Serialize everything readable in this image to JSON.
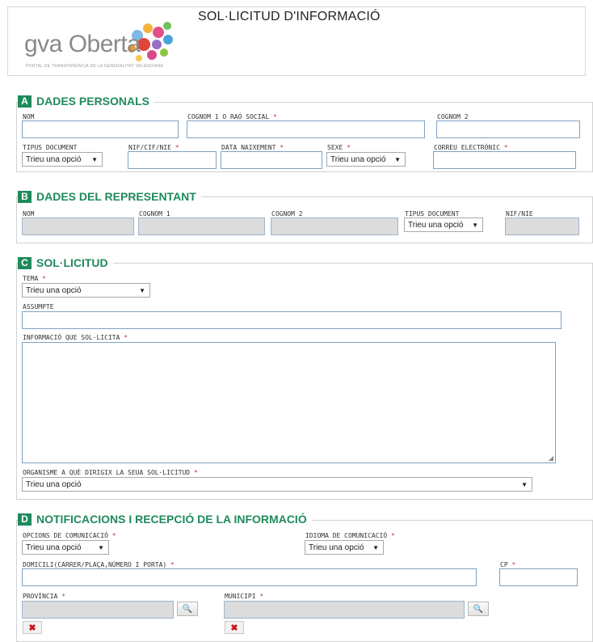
{
  "header": {
    "logo_text": "gva Oberta",
    "logo_subtitle": "PORTAL DE TRANSPARÈNCIA DE LA GENERALITAT VALENCIANA",
    "title": "SOL·LICITUD D'INFORMACIÓ"
  },
  "colors": {
    "accent": "#1f8a5c",
    "required": "#c0392b",
    "input_border": "#7fa3c2",
    "disabled_bg": "#dcdcdc"
  },
  "select_default": "Trieu una opció",
  "required_mark": "*",
  "icons": {
    "search": "magnifier-icon",
    "remove": "x-icon"
  },
  "sections": {
    "a": {
      "badge": "A",
      "title": "DADES PERSONALS",
      "fields": {
        "nom": "NOM",
        "cognom1": "COGNOM 1 O RAÓ SOCIAL",
        "cognom2": "COGNOM 2",
        "tipus_document": "TIPUS DOCUMENT",
        "nif": "NIF/CIF/NIE",
        "data_naixement": "DATA NAIXEMENT",
        "sexe": "SEXE",
        "correu": "CORREU ELECTRÒNIC"
      }
    },
    "b": {
      "badge": "B",
      "title": "DADES DEL REPRESENTANT",
      "fields": {
        "nom": "NOM",
        "cognom1": "COGNOM 1",
        "cognom2": "COGNOM 2",
        "tipus_document": "TIPUS DOCUMENT",
        "nif": "NIF/NIE"
      }
    },
    "c": {
      "badge": "C",
      "title": "SOL·LICITUD",
      "fields": {
        "tema": "TEMA",
        "assumpte": "ASSUMPTE",
        "informacio": "INFORMACIÓ QUE SOL·LICITA",
        "organisme": "ORGANISME A QUÈ DIRIGIX LA SEUA SOL·LICITUD"
      }
    },
    "d": {
      "badge": "D",
      "title": "NOTIFICACIONS I RECEPCIÓ DE LA INFORMACIÓ",
      "fields": {
        "opcions": "OPCIONS DE COMUNICACIÓ",
        "idioma": "IDIOMA DE COMUNICACIÓ",
        "domicili": "DOMICILI(CARRER/PLAÇA,NÚMERO I PORTA)",
        "cp": "CP",
        "provincia": "PROVÍNCIA",
        "municipi": "MUNICIPI"
      }
    }
  }
}
